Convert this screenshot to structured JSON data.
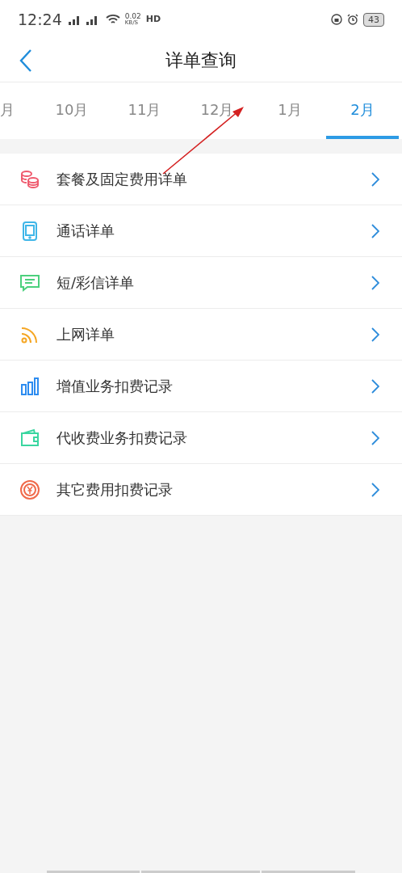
{
  "status_bar": {
    "time": "12:24",
    "speed": "0.02",
    "speed_unit": "KB/S",
    "hd": "HD",
    "battery": "43"
  },
  "header": {
    "title": "详单查询"
  },
  "tabs": [
    {
      "label": "月",
      "selected": false
    },
    {
      "label": "10月",
      "selected": false
    },
    {
      "label": "11月",
      "selected": false
    },
    {
      "label": "12月",
      "selected": false
    },
    {
      "label": "1月",
      "selected": false
    },
    {
      "label": "2月",
      "selected": true
    }
  ],
  "items": [
    {
      "label": "套餐及固定费用详单",
      "kind": "coins",
      "color": "#ef5b6e"
    },
    {
      "label": "通话详单",
      "kind": "phone",
      "color": "#3fb6e8"
    },
    {
      "label": "短/彩信详单",
      "kind": "message",
      "color": "#4cd07d"
    },
    {
      "label": "上网详单",
      "kind": "rss",
      "color": "#f5a623"
    },
    {
      "label": "增值业务扣费记录",
      "kind": "bars",
      "color": "#2d8cf0"
    },
    {
      "label": "代收费业务扣费记录",
      "kind": "wallet",
      "color": "#3ad6a0"
    },
    {
      "label": "其它费用扣费记录",
      "kind": "yen",
      "color": "#f06a4a"
    }
  ]
}
